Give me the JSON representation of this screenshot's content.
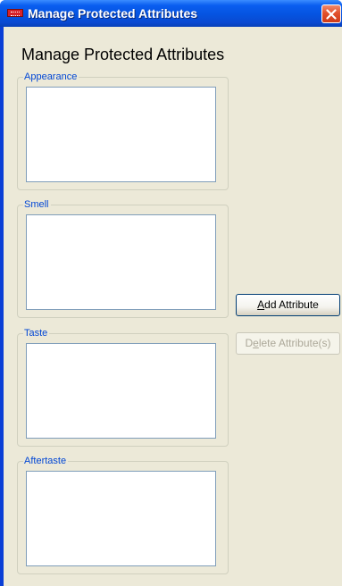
{
  "window": {
    "title": "Manage Protected Attributes"
  },
  "heading": "Manage Protected Attributes",
  "groups": [
    {
      "label": "Appearance"
    },
    {
      "label": "Smell"
    },
    {
      "label": "Taste"
    },
    {
      "label": "Aftertaste"
    }
  ],
  "buttons": {
    "add_attribute": {
      "prefix": "",
      "mnemonic": "A",
      "rest": "dd Attribute"
    },
    "delete_attribute": {
      "prefix": "D",
      "mnemonic": "e",
      "rest": "lete Attribute(s)",
      "enabled": false
    }
  },
  "icons": {
    "app": "app-icon",
    "close": "close-icon"
  },
  "colors": {
    "titlebar": "#0553e0",
    "client_bg": "#ece9d8",
    "group_label": "#0046d5",
    "close_button": "#e2512c"
  }
}
